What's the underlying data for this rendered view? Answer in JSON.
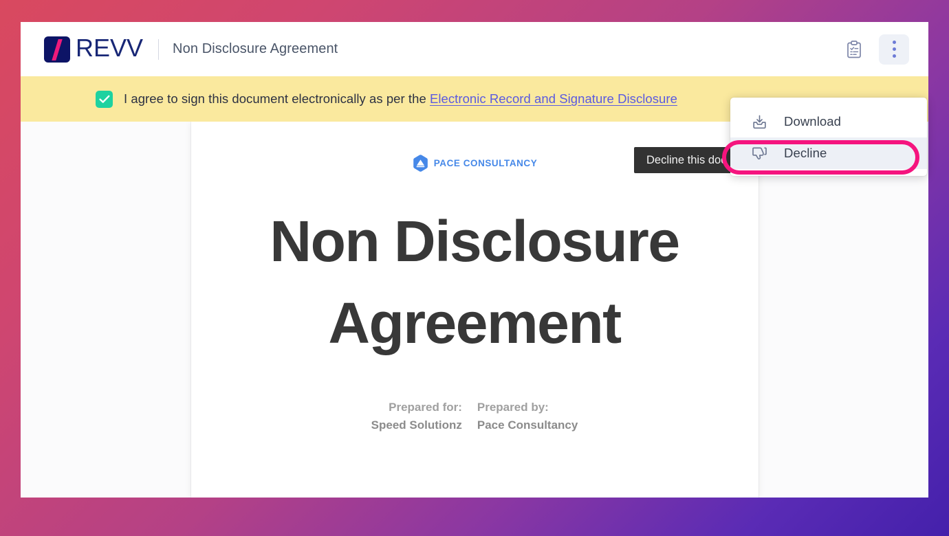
{
  "topbar": {
    "brand_name": "REVV",
    "logo_icon": "revv-slash-logo",
    "document_title": "Non Disclosure Agreement",
    "clipboard_icon": "clipboard-checklist-icon",
    "kebab_icon": "vertical-dots-icon"
  },
  "consent_banner": {
    "checkbox_checked": true,
    "text_before_link": "I agree to sign this document electronically as per the ",
    "link_text": "Electronic Record and Signature Disclosure",
    "background_color": "#fae99e",
    "checkbox_color": "#1ed2a0",
    "link_color": "#5a5ae0"
  },
  "actions_menu": {
    "items": [
      {
        "label": "Download",
        "icon": "download-tray-icon",
        "active": false
      },
      {
        "label": "Decline",
        "icon": "thumbs-down-icon",
        "active": true
      }
    ],
    "highlight_color": "#f5147e"
  },
  "tooltip": {
    "text": "Decline this doc",
    "background_color": "#323232"
  },
  "document": {
    "company_logo_icon": "pace-hexagon-logo",
    "company_name": "PACE CONSULTANCY",
    "company_color": "#4688e8",
    "heading_line_1": "Non Disclosure",
    "heading_line_2": "Agreement",
    "prepared": {
      "for_label": "Prepared for:",
      "for_value": "Speed Solutionz",
      "by_label": "Prepared by:",
      "by_value": "Pace Consultancy"
    }
  }
}
